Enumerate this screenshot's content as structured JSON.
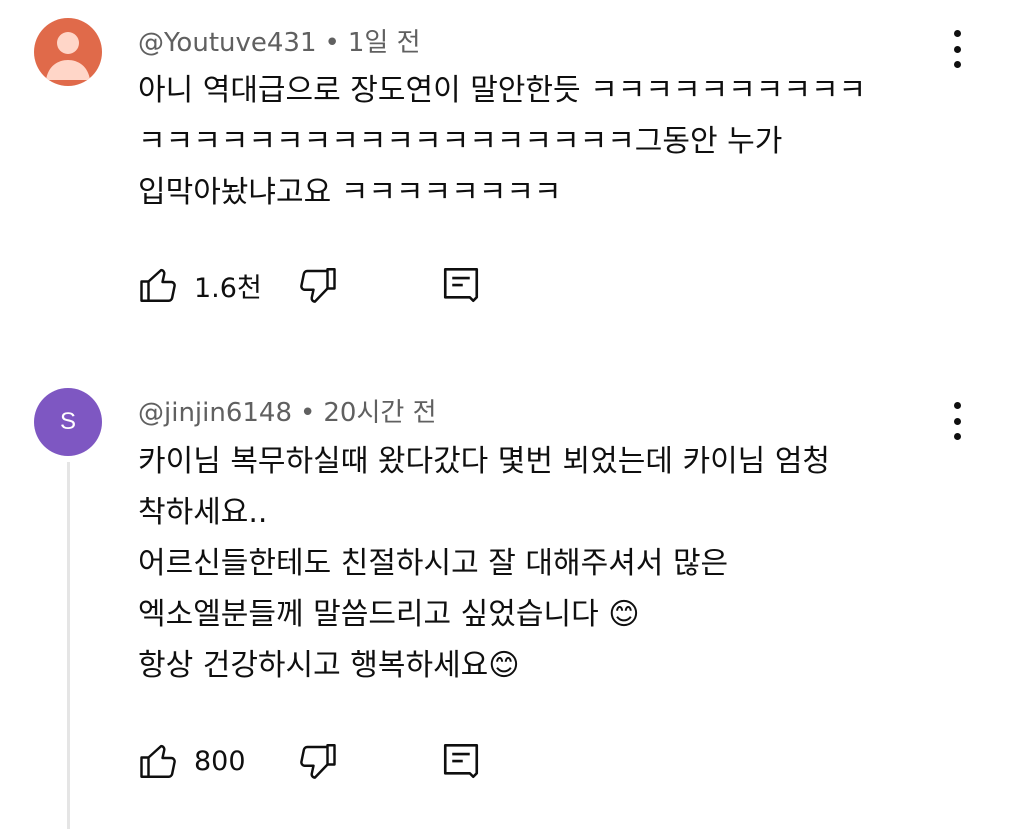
{
  "comments": [
    {
      "avatar_type": "default",
      "avatar_color": "#e06a4a",
      "author": "@Youtuve431",
      "separator": "•",
      "time": "1일 전",
      "text": "아니 역대급으로 장도연이 말안한듯 ㅋㅋㅋㅋㅋㅋㅋㅋㅋㅋ\nㅋㅋㅋㅋㅋㅋㅋㅋㅋㅋㅋㅋㅋㅋㅋㅋㅋㅋ그동안 누가\n입막아놨냐고요 ㅋㅋㅋㅋㅋㅋㅋㅋ",
      "likes": "1.6천"
    },
    {
      "avatar_type": "letter",
      "avatar_letter": "S",
      "avatar_color": "#7e57c2",
      "author": "@jinjin6148",
      "separator": "•",
      "time": "20시간 전",
      "text": "카이님 복무하실때 왔다갔다 몇번 뵈었는데 카이님 엄청\n착하세요..\n어르신들한테도 친절하시고 잘 대해주셔서 많은\n엑소엘분들께 말씀드리고 싶었습니다 😊\n항상 건강하시고 행복하세요😊",
      "likes": "800"
    }
  ],
  "icons": {
    "like": "thumb-up-icon",
    "dislike": "thumb-down-icon",
    "reply": "reply-icon",
    "more": "more-vertical-icon"
  }
}
